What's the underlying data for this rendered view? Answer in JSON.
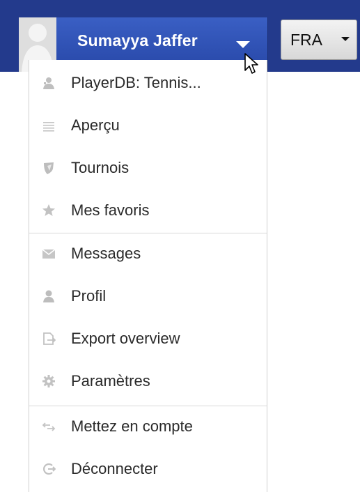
{
  "header": {
    "user_name": "Sumayya Jaffer",
    "language": "FRA",
    "bar_color": "#233a8c",
    "accent_color": "#2f52b8"
  },
  "menu": {
    "groups": [
      [
        {
          "label": "PlayerDB: Tennis...",
          "icon": "player-icon"
        },
        {
          "label": "Aperçu",
          "icon": "list-icon"
        },
        {
          "label": "Tournois",
          "icon": "shield-icon"
        },
        {
          "label": "Mes favoris",
          "icon": "star-icon"
        }
      ],
      [
        {
          "label": "Messages",
          "icon": "envelope-icon"
        },
        {
          "label": "Profil",
          "icon": "user-icon"
        },
        {
          "label": "Export overview",
          "icon": "export-icon"
        },
        {
          "label": "Paramètres",
          "icon": "gear-icon"
        }
      ],
      [
        {
          "label": "Mettez en compte",
          "icon": "switch-icon"
        },
        {
          "label": "Déconnecter",
          "icon": "logout-icon"
        }
      ]
    ]
  }
}
